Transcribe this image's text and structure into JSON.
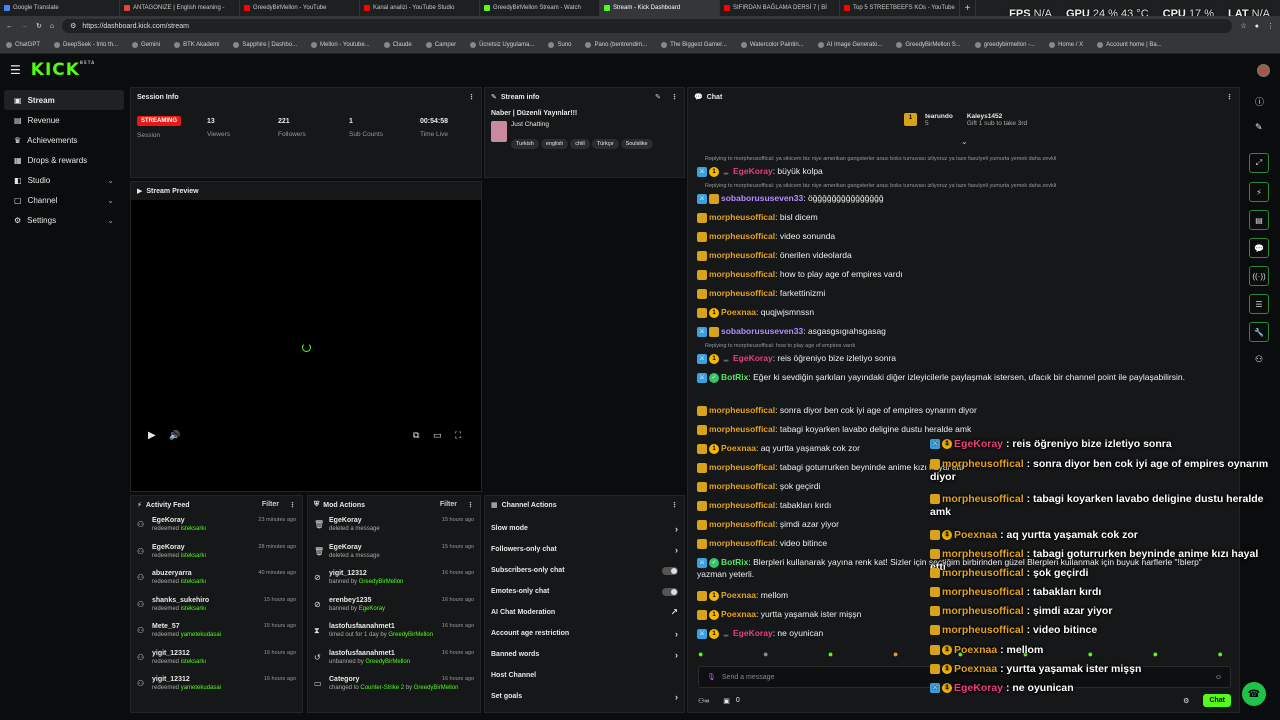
{
  "browser": {
    "tabs": [
      {
        "label": "Google Translate",
        "color": "#4285f4"
      },
      {
        "label": "ANTAGONIZE | English meaning -",
        "color": "#e94235"
      },
      {
        "label": "GreedyBirMellon - YouTube",
        "color": "#ff0000"
      },
      {
        "label": "Kanal analizi - YouTube Studio",
        "color": "#ff0000"
      },
      {
        "label": "GreedyBirMellon Stream - Watch",
        "color": "#53fc18"
      },
      {
        "label": "Stream - Kick Dashboard",
        "color": "#53fc18"
      },
      {
        "label": "SIFIRDAN BAĞLAMA DERSİ 7 | Bİ",
        "color": "#ff0000"
      },
      {
        "label": "Top 5 STREETBEEFS KOs - YouTube",
        "color": "#ff0000"
      }
    ],
    "new_tab": "+",
    "url": "https://dashboard.kick.com/stream",
    "bookmarks": [
      "ChatGPT",
      "DeepSeek - Into th...",
      "Gemini",
      "BTK Akademi",
      "Sapphire | Dashbo...",
      "Mellon - Youtube...",
      "Claude",
      "Camper",
      "Ücretsiz Uygulama...",
      "Suno",
      "Pano (bentrendim...",
      "The Biggest Gamer...",
      "Watercolor Paintin...",
      "AI Image Generato...",
      "GreedyBirMellon S...",
      "greedybirmellon -...",
      "Home / X",
      "Account home | Ba..."
    ]
  },
  "stats_overlay": {
    "fps_label": "FPS",
    "fps": "N/A",
    "gpu_label": "GPU",
    "gpu": "24 % 43 °C",
    "cpu_label": "CPU",
    "cpu": "17 %",
    "lat_label": "LAT",
    "lat": "N/A"
  },
  "app": {
    "logo": "KICK",
    "logo_badge": "BETA"
  },
  "sidebar": {
    "items": [
      {
        "label": "Stream",
        "icon": "broadcast-icon"
      },
      {
        "label": "Revenue",
        "icon": "wallet-icon"
      },
      {
        "label": "Achievements",
        "icon": "trophy-icon"
      },
      {
        "label": "Drops & rewards",
        "icon": "gift-icon"
      },
      {
        "label": "Studio",
        "icon": "studio-icon"
      },
      {
        "label": "Channel",
        "icon": "channel-icon"
      },
      {
        "label": "Settings",
        "icon": "gear-icon"
      }
    ]
  },
  "session": {
    "title": "Session Info",
    "status": "STREAMING",
    "session_label": "Session",
    "viewers": "13",
    "viewers_label": "Viewers",
    "followers": "221",
    "followers_label": "Followers",
    "subs": "1",
    "subs_label": "Sub Counts",
    "time": "00:54:58",
    "time_label": "Time Live"
  },
  "stream_info": {
    "title": "Stream info",
    "stream_title": "Naber | Düzenli Yayınlar!!!",
    "category": "Just Chatting",
    "tags": [
      "Turkish",
      "english",
      "chill",
      "Türkçe",
      "Soulslike"
    ]
  },
  "preview": {
    "title": "Stream Preview"
  },
  "activity": {
    "title": "Activity Feed",
    "filter": "Filter",
    "rows": [
      {
        "name": "EgeKoray",
        "action": "redeemed",
        "item": "isteksarkı",
        "time": "23 minutes ago"
      },
      {
        "name": "EgeKoray",
        "action": "redeemed",
        "item": "isteksarkı",
        "time": "28 minutes ago"
      },
      {
        "name": "abuzeryarra",
        "action": "redeemed",
        "item": "isteksarkı",
        "time": "40 minutes ago"
      },
      {
        "name": "shanks_sukehiro",
        "action": "redeemed",
        "item": "isteksarkı",
        "time": "15 hours ago"
      },
      {
        "name": "Mete_57",
        "action": "redeemed",
        "item": "yametekudasai",
        "time": "15 hours ago"
      },
      {
        "name": "yigit_12312",
        "action": "redeemed",
        "item": "isteksarkı",
        "time": "16 hours ago"
      },
      {
        "name": "yigit_12312",
        "action": "redeemed",
        "item": "yametekudasai",
        "time": "16 hours ago"
      }
    ]
  },
  "mod": {
    "title": "Mod Actions",
    "filter": "Filter",
    "rows": [
      {
        "name": "EgeKoray",
        "detail": "deleted a message",
        "by": "",
        "time": "15 hours ago",
        "icon": "trash-icon"
      },
      {
        "name": "EgeKoray",
        "detail": "deleted a message",
        "by": "",
        "time": "15 hours ago",
        "icon": "trash-icon"
      },
      {
        "name": "yigit_12312",
        "detail": "banned by",
        "by": "GreedyBirMellon",
        "time": "16 hours ago",
        "icon": "ban-icon"
      },
      {
        "name": "erenbey1235",
        "detail": "banned by",
        "by": "EgeKoray",
        "time": "16 hours ago",
        "icon": "ban-icon"
      },
      {
        "name": "lastofusfaanahmet1",
        "detail": "timed out for 1 day by",
        "by": "GreedyBirMellon",
        "time": "16 hours ago",
        "icon": "hourglass-icon"
      },
      {
        "name": "lastofusfaanahmet1",
        "detail": "unbanned by",
        "by": "GreedyBirMellon",
        "time": "16 hours ago",
        "icon": "undo-icon"
      },
      {
        "name": "Category",
        "detail": "changed to",
        "by": "Counter-Strike 2",
        "by2": "by",
        "by3": "GreedyBirMellon",
        "time": "16 hours ago",
        "icon": "folder-icon"
      }
    ]
  },
  "channel_actions": {
    "title": "Channel Actions",
    "rows": [
      {
        "label": "Slow mode",
        "end": "›"
      },
      {
        "label": "Followers-only chat",
        "end": "›"
      },
      {
        "label": "Subscribers-only chat",
        "end": "toggle"
      },
      {
        "label": "Emotes-only chat",
        "end": "toggle"
      },
      {
        "label": "AI Chat Moderation",
        "end": "↗"
      },
      {
        "label": "Account age restriction",
        "end": "›"
      },
      {
        "label": "Banned words",
        "end": "›"
      },
      {
        "label": "Host Channel",
        "end": ""
      },
      {
        "label": "Set goals",
        "end": "›"
      }
    ]
  },
  "chat": {
    "title": "Chat",
    "pinned": {
      "user1": "tearundo",
      "count1": "5",
      "user2": "Kaleys1452",
      "gift": "Gift 1 sub to take 3rd"
    },
    "input_placeholder": "Send a message",
    "send": "Chat",
    "bottom_count": "0",
    "reply1": "Replying to morpheusoffical: ya sikicem biz niye amerikan gangsterler arası boks turnuvası izliyoruz ya taze fasulyeli yumurta yemek daha zevkli",
    "reply2": "Replying to morpheusoffical: ya sikicem biz niye amerikan gangsterler arası boks turnuvası izliyoruz ya taze fasulyeli yumurta yemek daha zevkli",
    "reply3": "Replying to morpheusoffical: how to play age of empires vardı",
    "messages": [
      {
        "user": "EgeKoray",
        "text": "büyük kolpa"
      },
      {
        "user": "sobaborususeven33",
        "text": "öğğğğğğğğğğğğğğğ"
      },
      {
        "user": "morpheusoffical",
        "text": "bisl dicem"
      },
      {
        "user": "morpheusoffical",
        "text": "video sonunda"
      },
      {
        "user": "morpheusoffical",
        "text": "önerilen videolarda"
      },
      {
        "user": "morpheusoffical",
        "text": "how to play age of empires vardı"
      },
      {
        "user": "morpheusoffical",
        "text": "farkettinizmi"
      },
      {
        "user": "Poexnaa",
        "text": "quqjwjsmnssn"
      },
      {
        "user": "sobaborususeven33",
        "text": "asgasgsıgıahsgasag"
      },
      {
        "user": "EgeKoray",
        "text": "reis öğreniyo bize izletiyo sonra"
      },
      {
        "user": "BotRix",
        "text": "Eğer ki sevdiğin şarkıları yayındaki diğer izleyicilerle paylaşmak istersen, ufacık bir channel point ile paylaşabilirsin."
      },
      {
        "user": "morpheusoffical",
        "text": "sonra diyor ben cok iyi age of empires oynarım diyor"
      },
      {
        "user": "morpheusoffical",
        "text": "tabagi koyarken lavabo deligine dustu heralde amk"
      },
      {
        "user": "Poexnaa",
        "text": "aq yurtta yaşamak cok zor"
      },
      {
        "user": "morpheusoffical",
        "text": "tabagi goturrurken beyninde anime kızı hayal etti"
      },
      {
        "user": "morpheusoffical",
        "text": "şok geçirdi"
      },
      {
        "user": "morpheusoffical",
        "text": "tabakları kırdı"
      },
      {
        "user": "morpheusoffical",
        "text": "şimdi azar yiyor"
      },
      {
        "user": "morpheusoffical",
        "text": "video bitince"
      },
      {
        "user": "BotRix",
        "text": "Blerpleri kullanarak yayına renk kat! Sizler için seçtiğim birbirinden güzel Blerpleri kullanmak için buyuk harflerle \"!blerp\" yazman yeterli."
      },
      {
        "user": "Poexnaa",
        "text": "mellom"
      },
      {
        "user": "Poexnaa",
        "text": "yurtta yaşamak ister mişşn"
      },
      {
        "user": "EgeKoray",
        "text": "ne oyunican"
      }
    ]
  },
  "overlay_chat": [
    {
      "user": "EgeKoray",
      "text": "reis öğreniyo bize izletiyo sonra"
    },
    {
      "user": "morpheusoffical",
      "text": "sonra diyor ben cok iyi age of empires oynarım diyor"
    },
    {
      "user": "morpheusoffical",
      "text": "tabagi koyarken lavabo deligine dustu heralde amk"
    },
    {
      "user": "Poexnaa",
      "text": "aq yurtta yaşamak cok zor"
    },
    {
      "user": "morpheusoffical",
      "text": "tabagi goturrurken beyninde anime kızı hayal etti"
    },
    {
      "user": "morpheusoffical",
      "text": "şok geçirdi"
    },
    {
      "user": "morpheusoffical",
      "text": "tabakları kırdı"
    },
    {
      "user": "morpheusoffical",
      "text": "şimdi azar yiyor"
    },
    {
      "user": "morpheusoffical",
      "text": "video bitince"
    },
    {
      "user": "Poexnaa",
      "text": "mellom"
    },
    {
      "user": "Poexnaa",
      "text": "yurtta yaşamak ister mişşn"
    },
    {
      "user": "EgeKoray",
      "text": "ne oyunican"
    }
  ],
  "colors": {
    "accent": "#53fc18",
    "live": "#e91916",
    "gold": "#e4a21b",
    "pink": "#e8407a"
  }
}
